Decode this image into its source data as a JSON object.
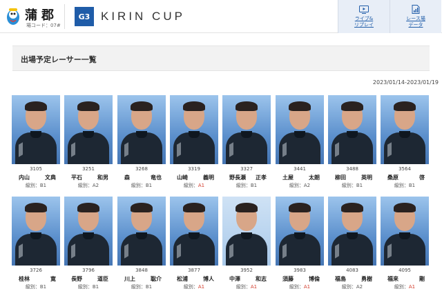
{
  "header": {
    "venue_name": "蒲郡",
    "venue_code": "場コード：07#",
    "grade": "G3",
    "race_title": "KIRIN CUP",
    "buttons": [
      {
        "label_line1": "ライブ&",
        "label_line2": "リプレイ",
        "icon": "tv-play-icon"
      },
      {
        "label_line1": "レース場",
        "label_line2": "データ",
        "icon": "chart-doc-icon"
      }
    ]
  },
  "section": {
    "title": "出場予定レーサー一覧",
    "date_range": "2023/01/14-2023/01/19",
    "rank_prefix": "級別："
  },
  "racers": [
    {
      "reg": "3105",
      "family": "内山",
      "given": "文典",
      "rank": "B1"
    },
    {
      "reg": "3251",
      "family": "平石",
      "given": "和男",
      "rank": "A2"
    },
    {
      "reg": "3268",
      "family": "森",
      "given": "竜也",
      "rank": "B1"
    },
    {
      "reg": "3319",
      "family": "山崎",
      "given": "義明",
      "rank": "A1"
    },
    {
      "reg": "3327",
      "family": "野長瀬",
      "given": "正孝",
      "rank": "B1"
    },
    {
      "reg": "3441",
      "family": "土屋",
      "given": "太朗",
      "rank": "A2"
    },
    {
      "reg": "3488",
      "family": "柳田",
      "given": "英明",
      "rank": "B1"
    },
    {
      "reg": "3564",
      "family": "桑原",
      "given": "啓",
      "rank": "B1"
    },
    {
      "reg": "3726",
      "family": "桂林",
      "given": "寛",
      "rank": "B1"
    },
    {
      "reg": "3796",
      "family": "長野",
      "given": "道臣",
      "rank": "B1"
    },
    {
      "reg": "3848",
      "family": "川上",
      "given": "聡介",
      "rank": "B1"
    },
    {
      "reg": "3877",
      "family": "松浦",
      "given": "博人",
      "rank": "A1"
    },
    {
      "reg": "3952",
      "family": "中澤",
      "given": "和志",
      "rank": "A1"
    },
    {
      "reg": "3983",
      "family": "須藤",
      "given": "博倫",
      "rank": "A1"
    },
    {
      "reg": "4083",
      "family": "福島",
      "given": "勇樹",
      "rank": "A2"
    },
    {
      "reg": "4095",
      "family": "福来",
      "given": "剛",
      "rank": "A1"
    }
  ]
}
